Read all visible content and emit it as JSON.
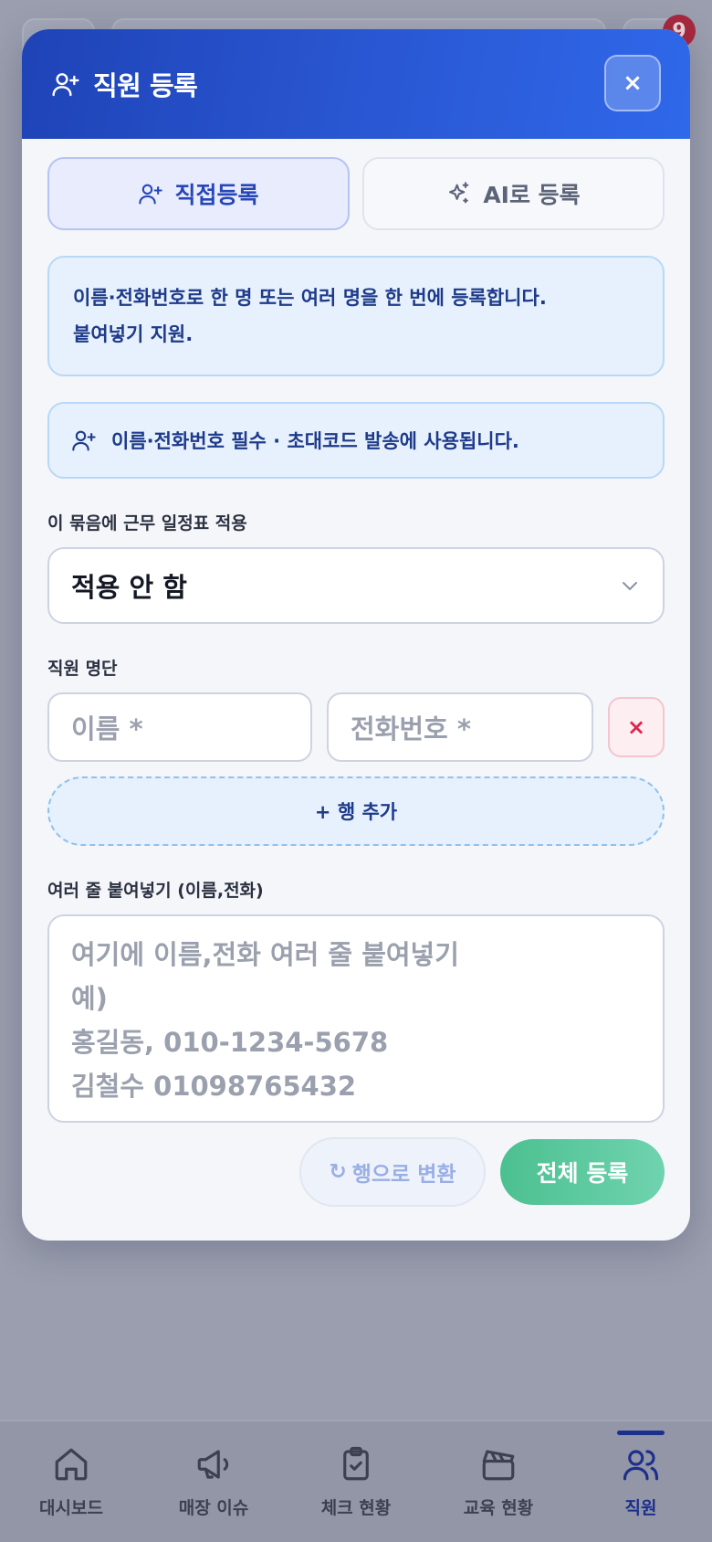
{
  "background": {
    "notification_count": "9"
  },
  "modal": {
    "title": "직원 등록",
    "close_label": "×",
    "tabs": [
      {
        "label": "직접등록",
        "icon": "user-plus-icon",
        "active": true
      },
      {
        "label": "AI로 등록",
        "icon": "sparkle-icon",
        "active": false
      }
    ],
    "info_text_line1": "이름·전화번호로 한 명 또는 여러 명을 한 번에 등록합니다.",
    "info_text_line2": "붙여넣기 지원.",
    "notice_text": "이름·전화번호 필수 · 초대코드 발송에 사용됩니다.",
    "schedule_label": "이 묶음에 근무 일정표 적용",
    "schedule_selected": "적용 안 함",
    "roster_label": "직원 명단",
    "name_placeholder": "이름 *",
    "phone_placeholder": "전화번호 *",
    "delete_row_label": "×",
    "add_row_label": "+ 행 추가",
    "paste_label": "여러 줄 붙여넣기 (이름,전화)",
    "paste_placeholder": "여기에 이름,전화 여러 줄 붙여넣기\n예)\n홍길동, 010-1234-5678\n김철수   01098765432",
    "convert_label": "행으로 변환",
    "convert_icon": "↻",
    "submit_label": "전체 등록"
  },
  "bottom_nav": [
    {
      "label": "대시보드",
      "icon": "home-icon",
      "active": false
    },
    {
      "label": "매장 이슈",
      "icon": "megaphone-icon",
      "active": false
    },
    {
      "label": "체크 현황",
      "icon": "clipboard-check-icon",
      "active": false
    },
    {
      "label": "교육 현황",
      "icon": "clapperboard-icon",
      "active": false
    },
    {
      "label": "직원",
      "icon": "users-icon",
      "active": true
    }
  ],
  "colors": {
    "header_start": "#1f43b7",
    "header_end": "#2f68ea",
    "accent": "#2747b8",
    "submit": "#4cc090",
    "danger": "#e0264f"
  }
}
